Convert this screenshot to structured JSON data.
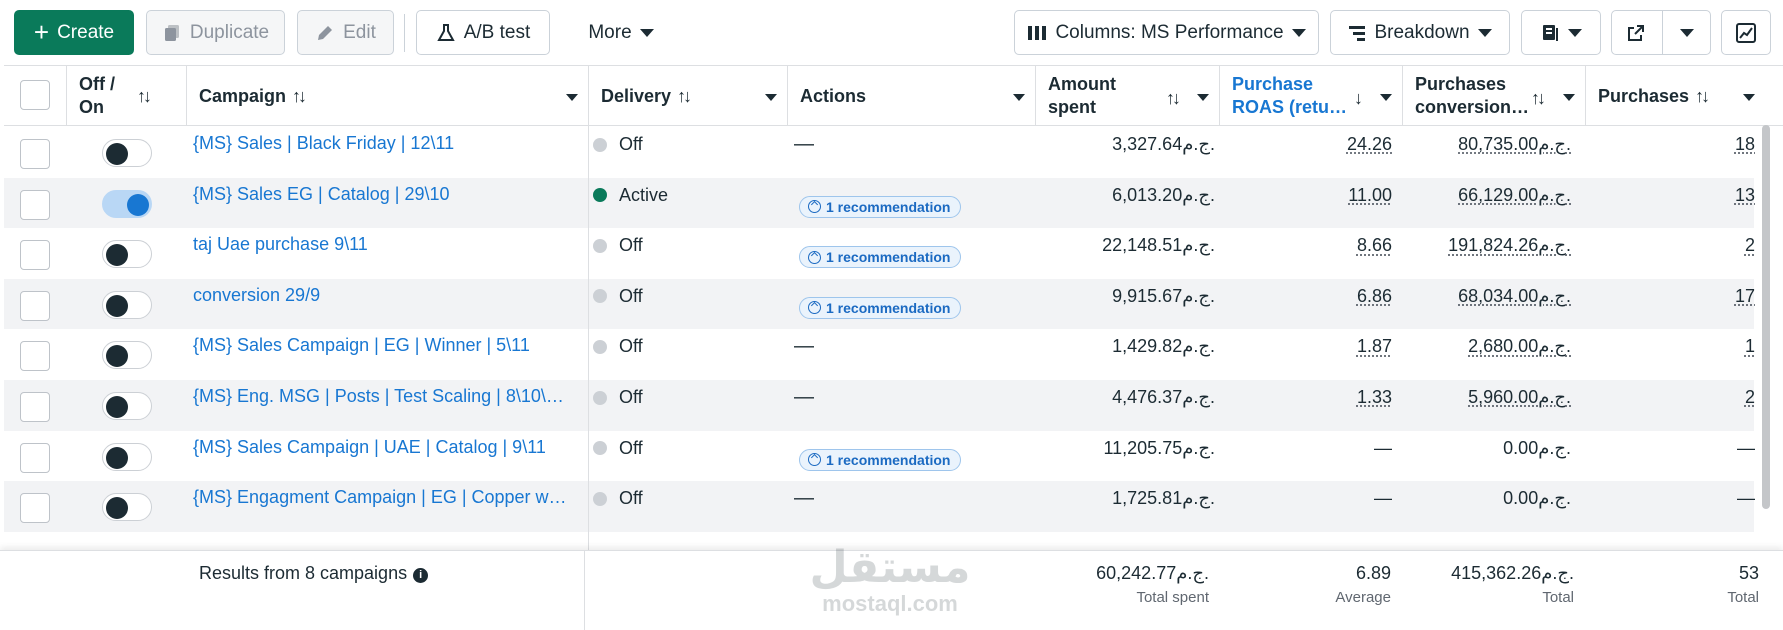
{
  "toolbar": {
    "create": "Create",
    "duplicate": "Duplicate",
    "edit": "Edit",
    "ab_test": "A/B test",
    "more": "More",
    "columns": "Columns: MS Performance",
    "breakdown": "Breakdown"
  },
  "headers": {
    "off_on_1": "Off /",
    "off_on_2": "On",
    "campaign": "Campaign",
    "delivery": "Delivery",
    "actions": "Actions",
    "amount_1": "Amount",
    "amount_2": "spent",
    "roas_1": "Purchase",
    "roas_2": "ROAS (retu…",
    "conv_1": "Purchases",
    "conv_2": "conversion…",
    "purchases": "Purchases"
  },
  "rows": [
    {
      "on": false,
      "campaign": "{MS} Sales | Black Friday | 12\\11",
      "delivery": "Off",
      "active": false,
      "action": "—",
      "reco": "",
      "amount": "3,327.64ج.م.",
      "roas": "24.26",
      "conv": "80,735.00ج.م.",
      "purchases": "18"
    },
    {
      "on": true,
      "campaign": "{MS} Sales EG | Catalog | 29\\10",
      "delivery": "Active",
      "active": true,
      "action": "",
      "reco": "1 recommendation",
      "amount": "6,013.20ج.م.",
      "roas": "11.00",
      "conv": "66,129.00ج.م.",
      "purchases": "13"
    },
    {
      "on": false,
      "campaign": "taj Uae purchase 9\\11",
      "delivery": "Off",
      "active": false,
      "action": "",
      "reco": "1 recommendation",
      "amount": "22,148.51ج.م.",
      "roas": "8.66",
      "conv": "191,824.26ج.م.",
      "purchases": "2"
    },
    {
      "on": false,
      "campaign": "conversion 29/9",
      "delivery": "Off",
      "active": false,
      "action": "",
      "reco": "1 recommendation",
      "amount": "9,915.67ج.م.",
      "roas": "6.86",
      "conv": "68,034.00ج.م.",
      "purchases": "17"
    },
    {
      "on": false,
      "campaign": "{MS} Sales Campaign | EG | Winner | 5\\11",
      "delivery": "Off",
      "active": false,
      "action": "—",
      "reco": "",
      "amount": "1,429.82ج.م.",
      "roas": "1.87",
      "conv": "2,680.00ج.م.",
      "purchases": "1"
    },
    {
      "on": false,
      "campaign": "{MS} Eng. MSG | Posts | Test Scaling | 8\\10\\2…",
      "delivery": "Off",
      "active": false,
      "action": "—",
      "reco": "",
      "amount": "4,476.37ج.م.",
      "roas": "1.33",
      "conv": "5,960.00ج.م.",
      "purchases": "2"
    },
    {
      "on": false,
      "campaign": "{MS} Sales Campaign | UAE | Catalog | 9\\11",
      "delivery": "Off",
      "active": false,
      "action": "",
      "reco": "1 recommendation",
      "amount": "11,205.75ج.م.",
      "roas": "—",
      "conv": "0.00ج.م.",
      "purchases": "—"
    },
    {
      "on": false,
      "campaign": "{MS} Engagment Campaign | EG | Copper wo…",
      "delivery": "Off",
      "active": false,
      "action": "—",
      "reco": "",
      "amount": "1,725.81ج.م.",
      "roas": "—",
      "conv": "0.00ج.م.",
      "purchases": "—"
    }
  ],
  "footer": {
    "results": "Results from 8 campaigns",
    "total_spent": "60,242.77ج.م.",
    "total_spent_label": "Total spent",
    "avg": "6.89",
    "avg_label": "Average",
    "total_conv": "415,362.26ج.م.",
    "total_conv_label": "Total",
    "total_purch": "53",
    "total_purch_label": "Total"
  },
  "watermark": {
    "ar": "مستقل",
    "en": "mostaql.com"
  }
}
